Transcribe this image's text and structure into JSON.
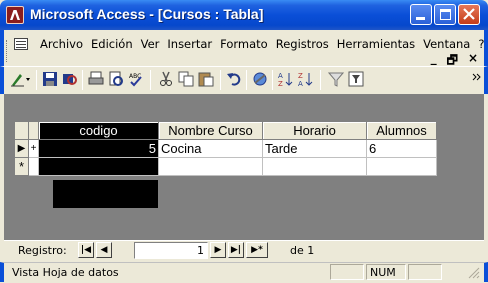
{
  "window": {
    "title": "Microsoft Access - [Cursos : Tabla]"
  },
  "menu": {
    "items": [
      "Archivo",
      "Edición",
      "Ver",
      "Insertar",
      "Formato",
      "Registros",
      "Herramientas",
      "Ventana",
      "?"
    ],
    "mdi_controls": [
      "_",
      "ᴮ",
      "×"
    ]
  },
  "toolbar": {
    "icons": [
      "design-view-icon",
      "save-icon",
      "search-icon",
      "print-icon",
      "print-preview-icon",
      "spelling-icon",
      "cut-icon",
      "copy-icon",
      "paste-icon",
      "undo-icon",
      "hyperlink-icon",
      "sort-ascending-icon",
      "sort-descending-icon",
      "filter-icon",
      "filter-by-form-icon",
      "more-icon"
    ]
  },
  "table": {
    "columns": [
      "codigo",
      "Nombre Curso",
      "Horario",
      "Alumnos"
    ],
    "rows": [
      {
        "codigo": "5",
        "nombre": "Cocina",
        "horario": "Tarde",
        "alumnos": "6"
      }
    ],
    "new_row_marker": "*",
    "current_row_marker": "▶",
    "expand_marker": "+"
  },
  "navigation": {
    "label": "Registro:",
    "current": "1",
    "total_text": "de 1"
  },
  "status": {
    "mode": "Vista Hoja de datos",
    "num": "NUM"
  },
  "colors": {
    "titlebar": "#0a4fd8",
    "chrome": "#ece9d8",
    "datasheet_bg": "#808080",
    "selected_column": "#000000"
  }
}
